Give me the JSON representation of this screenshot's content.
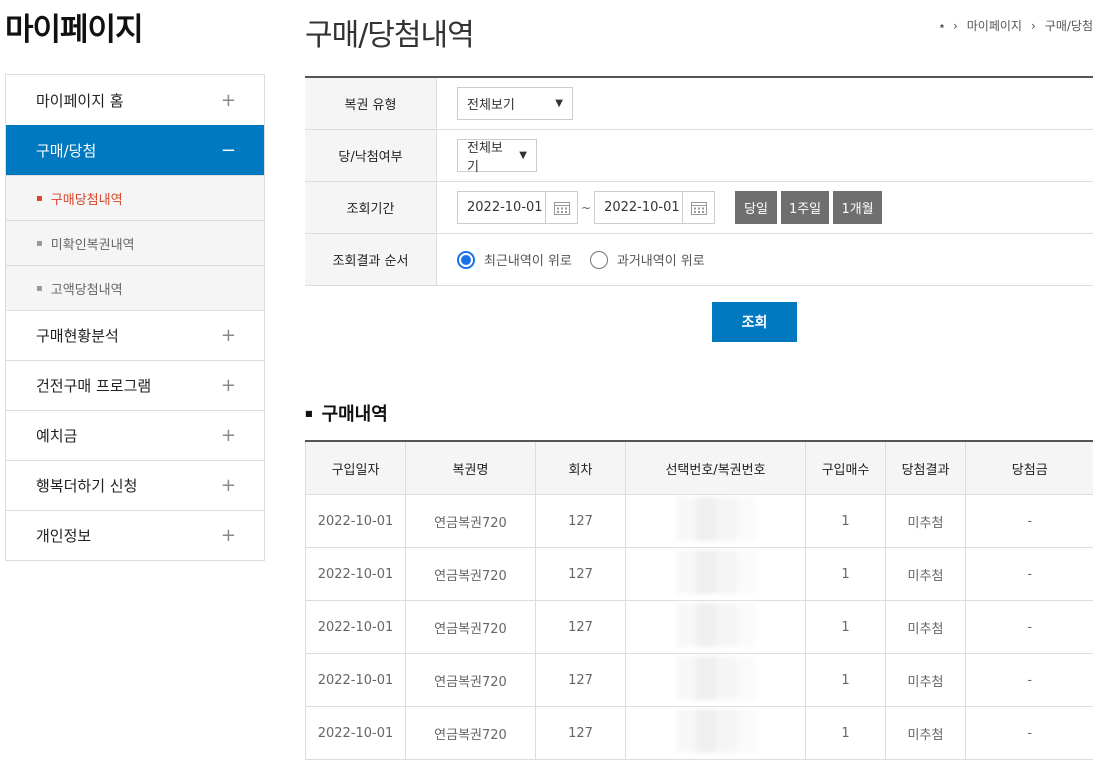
{
  "sidebar": {
    "title": "마이페이지",
    "items": [
      {
        "label": "마이페이지 홈",
        "sign": "+"
      },
      {
        "label": "구매/당첨",
        "sign": "−"
      },
      {
        "label": "구매현황분석",
        "sign": "+"
      },
      {
        "label": "건전구매 프로그램",
        "sign": "+"
      },
      {
        "label": "예치금",
        "sign": "+"
      },
      {
        "label": "행복더하기 신청",
        "sign": "+"
      },
      {
        "label": "개인정보",
        "sign": "+"
      }
    ],
    "subitems": [
      "구매당첨내역",
      "미확인복권내역",
      "고액당첨내역"
    ]
  },
  "header": {
    "title": "구매/당첨내역",
    "breadcrumb": [
      "마이페이지",
      "구매/당첨"
    ]
  },
  "form": {
    "type_label": "복권 유형",
    "type_value": "전체보기",
    "win_label": "당/낙첨여부",
    "win_value": "전체보기",
    "period_label": "조회기간",
    "start_date": "2022-10-01",
    "end_date": "2022-10-01",
    "tilde": "~",
    "quick": [
      "당일",
      "1주일",
      "1개월"
    ],
    "order_label": "조회결과 순서",
    "order_recent": "최근내역이 위로",
    "order_past": "과거내역이 위로",
    "search_label": "조회"
  },
  "section_title": "구매내역",
  "table": {
    "headers": [
      "구입일자",
      "복권명",
      "회차",
      "선택번호/복권번호",
      "구입매수",
      "당첨결과",
      "당첨금"
    ],
    "rows": [
      [
        "2022-10-01",
        "연금복권720",
        "127",
        "",
        "1",
        "미추첨",
        "-"
      ],
      [
        "2022-10-01",
        "연금복권720",
        "127",
        "",
        "1",
        "미추첨",
        "-"
      ],
      [
        "2022-10-01",
        "연금복권720",
        "127",
        "",
        "1",
        "미추첨",
        "-"
      ],
      [
        "2022-10-01",
        "연금복권720",
        "127",
        "",
        "1",
        "미추첨",
        "-"
      ],
      [
        "2022-10-01",
        "연금복권720",
        "127",
        "",
        "1",
        "미추첨",
        "-"
      ]
    ]
  },
  "colors": {
    "accent": "#0079c1",
    "current": "#d9442b",
    "gray_button": "#6f6f6f",
    "radio": "#1a73e8"
  }
}
